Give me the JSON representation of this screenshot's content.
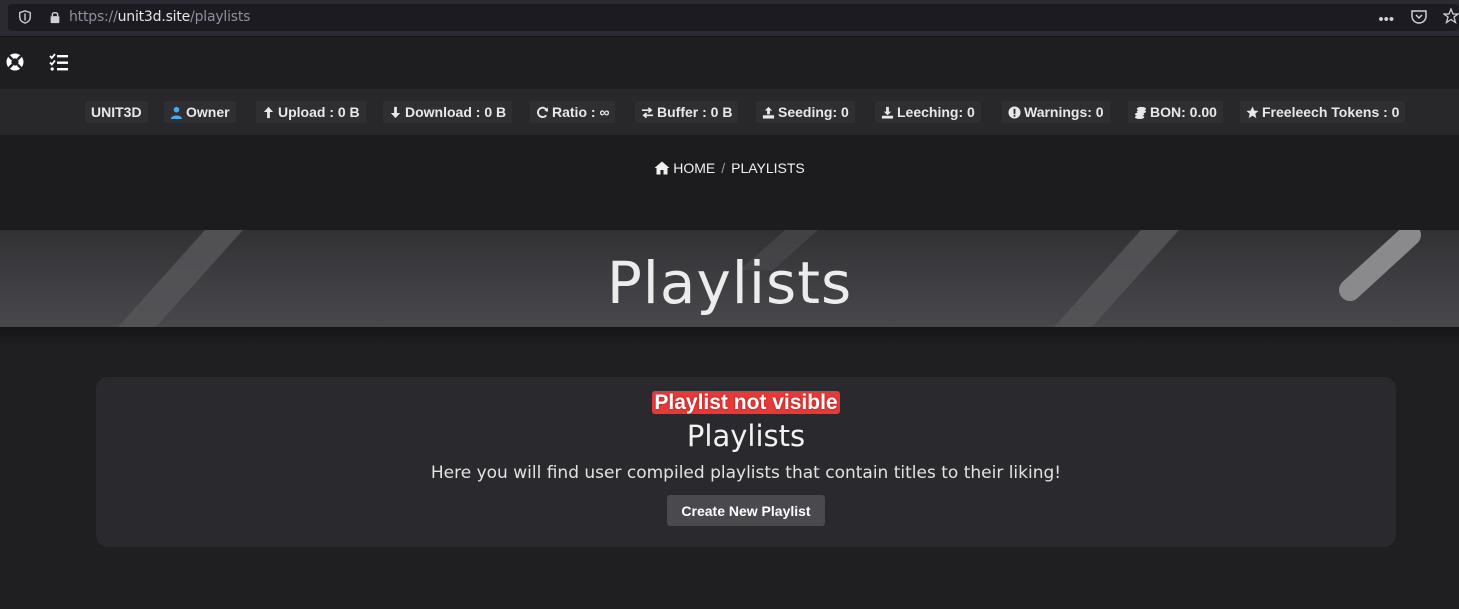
{
  "browser": {
    "url_scheme": "https://",
    "url_host": "unit3d.site",
    "url_path": "/playlists",
    "more_label": "•••"
  },
  "stats": {
    "brand": "UNIT3D",
    "owner": "Owner",
    "upload": "Upload : 0 B",
    "download": "Download : 0 B",
    "ratio": "Ratio : ∞",
    "buffer": "Buffer : 0 B",
    "seeding": "Seeding: 0",
    "leeching": "Leeching: 0",
    "warnings": "Warnings: 0",
    "bon": "BON: 0.00",
    "freeleech": "Freeleech Tokens : 0"
  },
  "breadcrumb": {
    "home": "HOME",
    "separator": "/",
    "current": "PLAYLISTS"
  },
  "banner": {
    "title": "Playlists"
  },
  "card": {
    "annotation": "Playlist not visible",
    "title": "Playlists",
    "description": "Here you will find user compiled playlists that contain titles to their liking!",
    "button": "Create New Playlist"
  },
  "colors": {
    "background": "#1f1f21",
    "card": "#2a2a2e",
    "annotation": "#e33a3a",
    "owner_icon": "#4aa8e8"
  },
  "icons": [
    "shield-icon",
    "lock-icon",
    "star-icon",
    "life-ring-icon",
    "checklist-icon",
    "user-icon",
    "arrow-up-icon",
    "arrow-down-icon",
    "refresh-icon",
    "exchange-icon",
    "upload-icon",
    "download-icon",
    "exclamation-icon",
    "coins-icon",
    "home-icon"
  ]
}
